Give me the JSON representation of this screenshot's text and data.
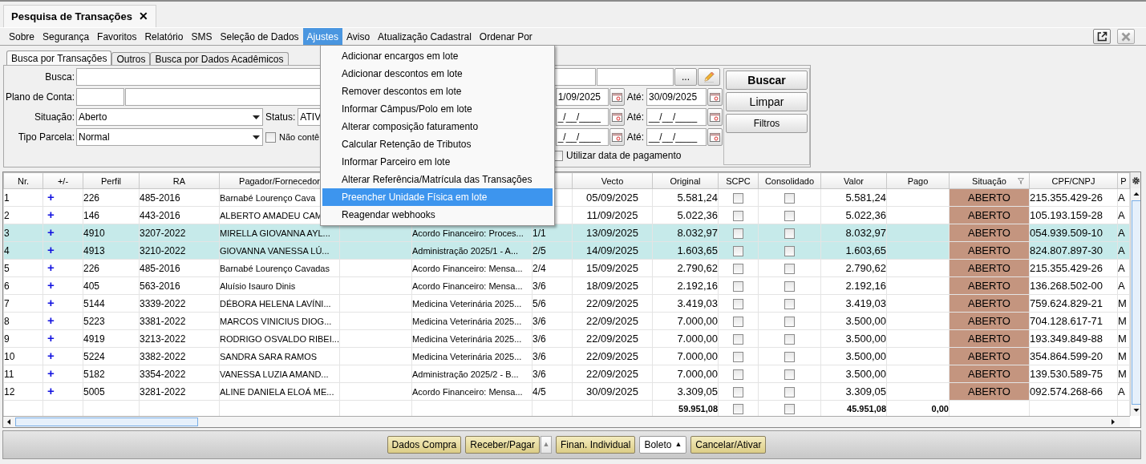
{
  "document_tab": {
    "title": "Pesquisa de Transações",
    "close": "✕"
  },
  "menu_bar": [
    {
      "label": "Sobre",
      "selected": false
    },
    {
      "label": "Segurança",
      "selected": false
    },
    {
      "label": "Favoritos",
      "selected": false
    },
    {
      "label": "Relatório",
      "selected": false
    },
    {
      "label": "SMS",
      "selected": false
    },
    {
      "label": "Seleção de Dados",
      "selected": false
    },
    {
      "label": "Ajustes",
      "selected": true
    },
    {
      "label": "Aviso",
      "selected": false
    },
    {
      "label": "Atualização Cadastral",
      "selected": false
    },
    {
      "label": "Ordenar Por",
      "selected": false
    }
  ],
  "search_tabs": [
    {
      "label": "Busca por Transações",
      "selected": true
    },
    {
      "label": "Outros",
      "selected": false
    },
    {
      "label": "Busca por Dados Acadêmicos",
      "selected": false
    }
  ],
  "filters": {
    "busca": {
      "label": "Busca:"
    },
    "browse_button": "...",
    "plano_de_conta": {
      "label": "Plano de Conta:"
    },
    "situacao": {
      "label": "Situação:",
      "value": "Aberto"
    },
    "status": {
      "label": "Status:",
      "value": "ATIV"
    },
    "tipo_parcela": {
      "label": "Tipo Parcela:",
      "value": "Normal"
    },
    "nao_contem": {
      "label": "Não contê",
      "checked": false
    },
    "date_ranges": [
      {
        "from": "1/09/2025",
        "to_label": "Até:",
        "to": "30/09/2025"
      },
      {
        "from": "_/__/____",
        "to_label": "Até:",
        "to": "__/__/____"
      },
      {
        "from": "_/__/____",
        "to_label": "Até:",
        "to": "__/__/____"
      }
    ],
    "utilizar_data_pagamento": {
      "label": "Utilizar data de pagamento",
      "checked": false
    }
  },
  "actions": [
    "Buscar",
    "Limpar",
    "Filtros"
  ],
  "dropdown_menu": {
    "items": [
      {
        "label": "Adicionar encargos em lote",
        "selected": false
      },
      {
        "label": "Adicionar descontos em lote",
        "selected": false
      },
      {
        "label": "Remover descontos em lote",
        "selected": false
      },
      {
        "label": "Informar Câmpus/Polo em lote",
        "selected": false
      },
      {
        "label": "Alterar composição faturamento",
        "selected": false
      },
      {
        "label": "Calcular Retenção de Tributos",
        "selected": false
      },
      {
        "label": "Informar Parceiro em lote",
        "selected": false
      },
      {
        "label": "Alterar Referência/Matrícula das Transações",
        "selected": false
      },
      {
        "label": "Preencher Unidade Física em lote",
        "selected": true
      },
      {
        "label": "Reagendar webhooks",
        "selected": false
      }
    ]
  },
  "table": {
    "headers": {
      "nr": "Nr.",
      "toggle": "+/-",
      "perfil": "Perfil",
      "ra": "RA",
      "pagador": "Pagador/Fornecedor",
      "vecto": "Vecto",
      "original": "Original",
      "scpc": "SCPC",
      "consolidado": "Consolidado",
      "valor": "Valor",
      "pago": "Pago",
      "situacao": "Situação",
      "cpf_cnpj": "CPF/CNPJ",
      "column_17": "P"
    },
    "rows": [
      {
        "nr": "1",
        "toggle": "+",
        "perfil": "226",
        "ra": "485-2016",
        "pagador": "Barnabé Lourenço Cava",
        "vecto": "05/09/2025",
        "original": "5.581,24",
        "scpc": false,
        "consolidado": false,
        "valor": "5.581,24",
        "situacao": "ABERTO",
        "cpf_cnpj": "215.355.429-26",
        "column_17": "A",
        "selected": false
      },
      {
        "nr": "2",
        "toggle": "+",
        "perfil": "146",
        "ra": "443-2016",
        "pagador": "ALBERTO AMADEU CAM",
        "vecto": "11/09/2025",
        "original": "5.022,36",
        "scpc": false,
        "consolidado": false,
        "valor": "5.022,36",
        "situacao": "ABERTO",
        "cpf_cnpj": "105.193.159-28",
        "column_17": "A",
        "selected": false
      },
      {
        "nr": "3",
        "toggle": "+",
        "perfil": "4910",
        "ra": "3207-2022",
        "pagador": "MIRELLA GIOVANNA AYL...",
        "descricao": "Acordo Financeiro: Proces...",
        "parcela": "1/1",
        "vecto": "13/09/2025",
        "original": "8.032,97",
        "scpc": false,
        "consolidado": false,
        "valor": "8.032,97",
        "situacao": "ABERTO",
        "cpf_cnpj": "054.939.509-10",
        "column_17": "A",
        "selected": true
      },
      {
        "nr": "4",
        "toggle": "+",
        "perfil": "4913",
        "ra": "3210-2022",
        "pagador": "GIOVANNA VANESSA LÚ...",
        "descricao": "Administração 2025/1 - A...",
        "parcela": "2/5",
        "vecto": "14/09/2025",
        "original": "1.603,65",
        "scpc": false,
        "consolidado": false,
        "valor": "1.603,65",
        "situacao": "ABERTO",
        "cpf_cnpj": "824.807.897-30",
        "column_17": "A",
        "selected": true
      },
      {
        "nr": "5",
        "toggle": "+",
        "perfil": "226",
        "ra": "485-2016",
        "pagador": "Barnabé Lourenço Cavadas",
        "descricao": "Acordo Financeiro: Mensa...",
        "parcela": "2/4",
        "vecto": "15/09/2025",
        "original": "2.790,62",
        "scpc": false,
        "consolidado": false,
        "valor": "2.790,62",
        "situacao": "ABERTO",
        "cpf_cnpj": "215.355.429-26",
        "column_17": "A",
        "selected": false
      },
      {
        "nr": "6",
        "toggle": "+",
        "perfil": "405",
        "ra": "563-2016",
        "pagador": "Aluísio Isauro Dinis",
        "descricao": "Acordo Financeiro: Mensa...",
        "parcela": "3/6",
        "vecto": "18/09/2025",
        "original": "2.192,16",
        "scpc": false,
        "consolidado": false,
        "valor": "2.192,16",
        "situacao": "ABERTO",
        "cpf_cnpj": "136.268.502-00",
        "column_17": "A",
        "selected": false
      },
      {
        "nr": "7",
        "toggle": "+",
        "perfil": "5144",
        "ra": "3339-2022",
        "pagador": "DÉBORA HELENA LAVÍNI...",
        "descricao": "Medicina Veterinária 2025...",
        "parcela": "5/6",
        "vecto": "22/09/2025",
        "original": "3.419,03",
        "scpc": false,
        "consolidado": false,
        "valor": "3.419,03",
        "situacao": "ABERTO",
        "cpf_cnpj": "759.624.829-21",
        "column_17": "M",
        "selected": false
      },
      {
        "nr": "8",
        "toggle": "+",
        "perfil": "5223",
        "ra": "3381-2022",
        "pagador": "MARCOS VINICIUS DIOG...",
        "descricao": "Medicina Veterinária 2025...",
        "parcela": "3/6",
        "vecto": "22/09/2025",
        "original": "7.000,00",
        "scpc": false,
        "consolidado": false,
        "valor": "3.500,00",
        "situacao": "ABERTO",
        "cpf_cnpj": "704.128.617-71",
        "column_17": "M",
        "selected": false
      },
      {
        "nr": "9",
        "toggle": "+",
        "perfil": "4919",
        "ra": "3213-2022",
        "pagador": "RODRIGO OSVALDO RIBEI...",
        "descricao": "Medicina Veterinária 2025...",
        "parcela": "3/6",
        "vecto": "22/09/2025",
        "original": "7.000,00",
        "scpc": false,
        "consolidado": false,
        "valor": "3.500,00",
        "situacao": "ABERTO",
        "cpf_cnpj": "193.349.849-88",
        "column_17": "M",
        "selected": false
      },
      {
        "nr": "10",
        "toggle": "+",
        "perfil": "5224",
        "ra": "3382-2022",
        "pagador": "SANDRA SARA RAMOS",
        "descricao": "Medicina Veterinária 2025...",
        "parcela": "3/6",
        "vecto": "22/09/2025",
        "original": "7.000,00",
        "scpc": false,
        "consolidado": false,
        "valor": "3.500,00",
        "situacao": "ABERTO",
        "cpf_cnpj": "354.864.599-20",
        "column_17": "M",
        "selected": false
      },
      {
        "nr": "11",
        "toggle": "+",
        "perfil": "5182",
        "ra": "3354-2022",
        "pagador": "VANESSA LUZIA AMAND...",
        "descricao": "Administração 2025/2 - B...",
        "parcela": "3/6",
        "vecto": "22/09/2025",
        "original": "7.000,00",
        "scpc": false,
        "consolidado": false,
        "valor": "3.500,00",
        "situacao": "ABERTO",
        "cpf_cnpj": "139.530.589-75",
        "column_17": "M",
        "selected": false
      },
      {
        "nr": "12",
        "toggle": "+",
        "perfil": "5005",
        "ra": "3281-2022",
        "pagador": "ALINE DANIELA ELOÁ ME...",
        "descricao": "Acordo Financeiro: Mensa...",
        "parcela": "4/5",
        "vecto": "30/09/2025",
        "original": "3.309,05",
        "scpc": false,
        "consolidado": false,
        "valor": "3.309,05",
        "situacao": "ABERTO",
        "cpf_cnpj": "092.574.268-66",
        "column_17": "A",
        "selected": false
      }
    ],
    "totals": {
      "original": "59.951,08",
      "scpc": false,
      "consolidado": false,
      "valor": "45.951,08",
      "pago": "0,00"
    }
  },
  "bottom_buttons": [
    {
      "label": "Dados Compra",
      "kind": "action"
    },
    {
      "label": "Receber/Pagar",
      "kind": "action"
    },
    {
      "label": "▲",
      "kind": "arrow"
    },
    {
      "label": "Finan. Individual",
      "kind": "action"
    },
    {
      "label": "Boleto",
      "caret": "▲",
      "kind": "menu"
    },
    {
      "label": "Cancelar/Ativar",
      "kind": "action"
    }
  ]
}
